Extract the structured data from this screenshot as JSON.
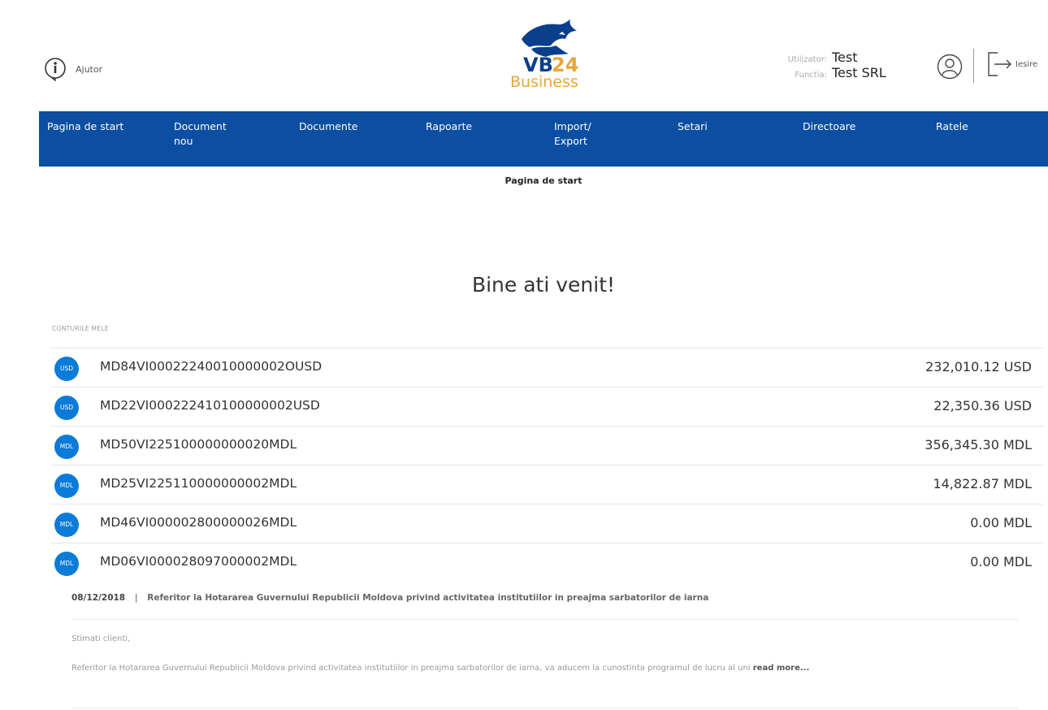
{
  "header": {
    "help_label": "Ajutor",
    "logo_text": "VB24",
    "logo_sub": "Business",
    "user_key": "Utilizator:",
    "user_value": "Test",
    "function_key": "Functia:",
    "function_value": "Test SRL",
    "logout_label": "Iesire"
  },
  "nav": {
    "items": [
      {
        "label": "Pagina de start"
      },
      {
        "label": "Document\nnou"
      },
      {
        "label": "Documente"
      },
      {
        "label": "Rapoarte"
      },
      {
        "label": "Import/\nExport"
      },
      {
        "label": "Setari"
      },
      {
        "label": "Directoare"
      },
      {
        "label": "Ratele"
      }
    ]
  },
  "breadcrumb": "Pagina de start",
  "welcome": "Bine ati venit!",
  "section_title": "CONTURILE MELE",
  "accounts": [
    {
      "currency": "USD",
      "number": "MD84VI00022240010000002OUSD",
      "balance": "232,010.12 USD"
    },
    {
      "currency": "USD",
      "number": "MD22VI000222410100000002USD",
      "balance": "22,350.36 USD"
    },
    {
      "currency": "MDL",
      "number": "MD50VI225100000000020MDL",
      "balance": "356,345.30 MDL"
    },
    {
      "currency": "MDL",
      "number": "MD25VI225110000000002MDL",
      "balance": "14,822.87 MDL"
    },
    {
      "currency": "MDL",
      "number": "MD46VI000002800000026MDL",
      "balance": "0.00 MDL"
    },
    {
      "currency": "MDL",
      "number": "MD06VI000028097000002MDL",
      "balance": "0.00 MDL"
    }
  ],
  "news": {
    "date": "08/12/2018",
    "separator": "|",
    "title": "Referitor la Hotararea Guvernului Republicii Moldova privind activitatea institutiilor in preajma sarbatorilor de iarna",
    "greeting": "Stimati clienti,",
    "excerpt": "Referitor la Hotararea Guvernului Republicii Moldova privind activitatea institutiilor in preajma sarbatorilor de iarna, va aducem la cunostinta programul de lucru al uni ",
    "read_more": "read more..."
  },
  "colors": {
    "nav_bg": "#0b4ea2",
    "badge_bg": "#0b7bd8",
    "logo_gold": "#e7a63b"
  }
}
